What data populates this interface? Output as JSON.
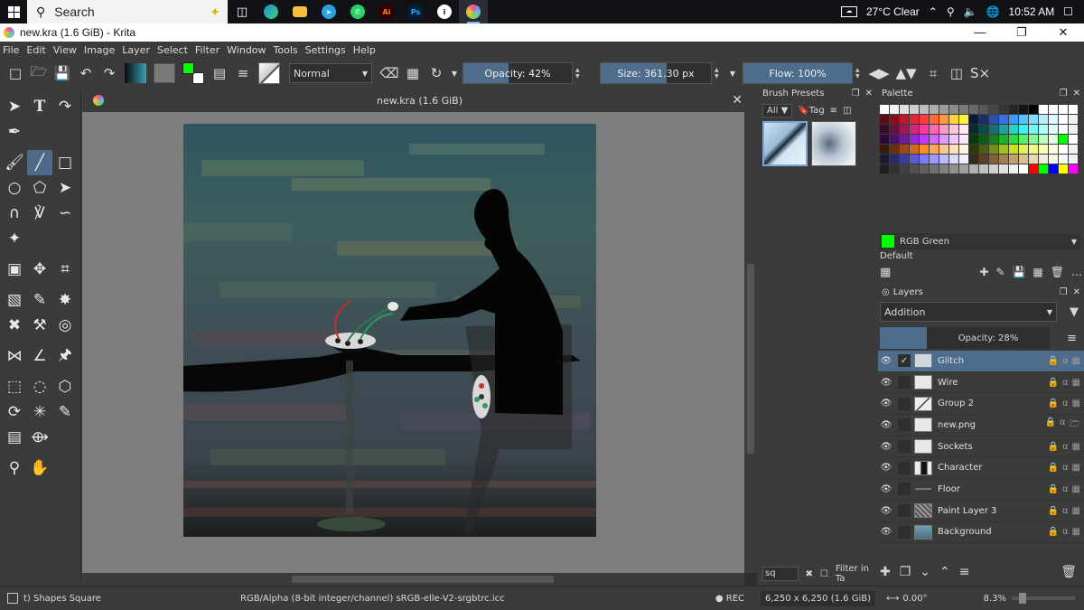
{
  "taskbar": {
    "search_placeholder": "Search",
    "weather": "27°C  Clear",
    "time": "10:52 AM",
    "apps": [
      "task-view",
      "edge",
      "file-explorer",
      "telegram",
      "whatsapp",
      "illustrator",
      "photoshop",
      "unknown-app",
      "krita"
    ],
    "illustrator_label": "Ai",
    "photoshop_label": "Ps"
  },
  "window": {
    "title": "new.kra (1.6 GiB)  - Krita",
    "doc_title": "new.kra (1.6 GiB)"
  },
  "menu": [
    "File",
    "Edit",
    "View",
    "Image",
    "Layer",
    "Select",
    "Filter",
    "Window",
    "Tools",
    "Settings",
    "Help"
  ],
  "tool_options": {
    "blend_mode": "Normal",
    "opacity_label": "Opacity: 42%",
    "opacity_value": 0.42,
    "size_label": "Size: 361.30 px",
    "flow_label": "Flow: 100%",
    "flow_value": 1.0,
    "fg_color": "#00ff00",
    "bg_color": "#ffffff"
  },
  "brush_presets": {
    "title": "Brush Presets",
    "filter_all": "All",
    "tag_label": "Tag",
    "search_value": "sq",
    "filter_in_tag": "Filter in Ta"
  },
  "palette": {
    "title": "Palette",
    "current_color_name": "RGB Green",
    "palette_name": "Default",
    "colors": [
      "#ffffff",
      "#f2f2f2",
      "#e0e0e0",
      "#cfcfcf",
      "#bebebe",
      "#adadad",
      "#9c9c9c",
      "#8b8b8b",
      "#7a7a7a",
      "#696969",
      "#585858",
      "#474747",
      "#363636",
      "#252525",
      "#141414",
      "#000000",
      "#ffffff",
      "#ffffff",
      "#ffffff",
      "#ffffff",
      "#5a0a12",
      "#8a0f1f",
      "#c0182b",
      "#e0283b",
      "#ff3b3b",
      "#ff6a3b",
      "#ff9a3b",
      "#ffd23b",
      "#fff23b",
      "#0a1a3a",
      "#1a2f6a",
      "#2a4fb0",
      "#3b6fe0",
      "#3b9aff",
      "#5ac0ff",
      "#8ad8ff",
      "#b8ecff",
      "#e0f8ff",
      "#ffffff",
      "#f0f0f0",
      "#3a0a2a",
      "#6a1040",
      "#a0185a",
      "#d0287a",
      "#ff3b9a",
      "#ff6ab0",
      "#ff9ac8",
      "#ffc8e0",
      "#ffe8f0",
      "#0a2a2a",
      "#0f4a4a",
      "#187070",
      "#20a0a0",
      "#28d0d0",
      "#3bf0f0",
      "#7af8f8",
      "#b0ffff",
      "#e0ffff",
      "#ffffff",
      "#f0f0f0",
      "#2a0a3a",
      "#4a106a",
      "#7018a0",
      "#9a28d0",
      "#c03bff",
      "#d06aff",
      "#e09aff",
      "#f0c8ff",
      "#f8e8ff",
      "#0a3a0a",
      "#0f5a14",
      "#188020",
      "#20b02a",
      "#28e03b",
      "#5af06a",
      "#8af89a",
      "#b8ffc0",
      "#e0ffe4",
      "#00ff00",
      "#ffffff",
      "#3a1a0a",
      "#6a3010",
      "#a04818",
      "#d06a20",
      "#ff8a28",
      "#ffa85a",
      "#ffc88a",
      "#ffe0b8",
      "#fff4e0",
      "#2a3a0a",
      "#4a6010",
      "#709018",
      "#a0c020",
      "#c8e028",
      "#e0f05a",
      "#f0f88a",
      "#f8ffb8",
      "#fcffe0",
      "#ffffff",
      "#f0f0f0",
      "#1a1a3a",
      "#2a2a6a",
      "#3b3ba0",
      "#5a5ad0",
      "#7a7aff",
      "#9a9aff",
      "#babaff",
      "#dadaff",
      "#f0f0ff",
      "#3a2a1a",
      "#5a4028",
      "#80603b",
      "#a08050",
      "#c0a070",
      "#d8c090",
      "#e8d8b8",
      "#f4ecdc",
      "#fcf8f0",
      "#ffffff",
      "#f0f0f0",
      "#202020",
      "#303030",
      "#404040",
      "#505050",
      "#606060",
      "#707070",
      "#808080",
      "#909090",
      "#a0a0a0",
      "#b0b0b0",
      "#c0c0c0",
      "#d0d0d0",
      "#e0e0e0",
      "#f0f0f0",
      "#ffffff",
      "#ff0000",
      "#00ff00",
      "#0000ff",
      "#ffff00",
      "#ff00ff"
    ]
  },
  "layers": {
    "title": "Layers",
    "blend_mode": "Addition",
    "opacity_label": "Opacity:  28%",
    "opacity_value": 0.28,
    "items": [
      {
        "name": "Glitch",
        "selected": true,
        "checked": true
      },
      {
        "name": "Wire",
        "selected": false,
        "checked": false
      },
      {
        "name": "Group 2",
        "selected": false,
        "checked": false
      },
      {
        "name": "new.png",
        "selected": false,
        "checked": false
      },
      {
        "name": "Sockets",
        "selected": false,
        "checked": false
      },
      {
        "name": "Character",
        "selected": false,
        "checked": false
      },
      {
        "name": "Floor",
        "selected": false,
        "checked": false
      },
      {
        "name": "Paint Layer 3",
        "selected": false,
        "checked": false
      },
      {
        "name": "Background",
        "selected": false,
        "checked": false
      }
    ]
  },
  "status": {
    "tool": "t) Shapes Square",
    "color_space": "RGB/Alpha (8-bit integer/channel)  sRGB-elle-V2-srgbtrc.icc",
    "rec": "● REC",
    "image_size": "6,250 x 6,250 (1.6 GiB)",
    "rotation": "0.00°",
    "zoom": "8.3%"
  }
}
